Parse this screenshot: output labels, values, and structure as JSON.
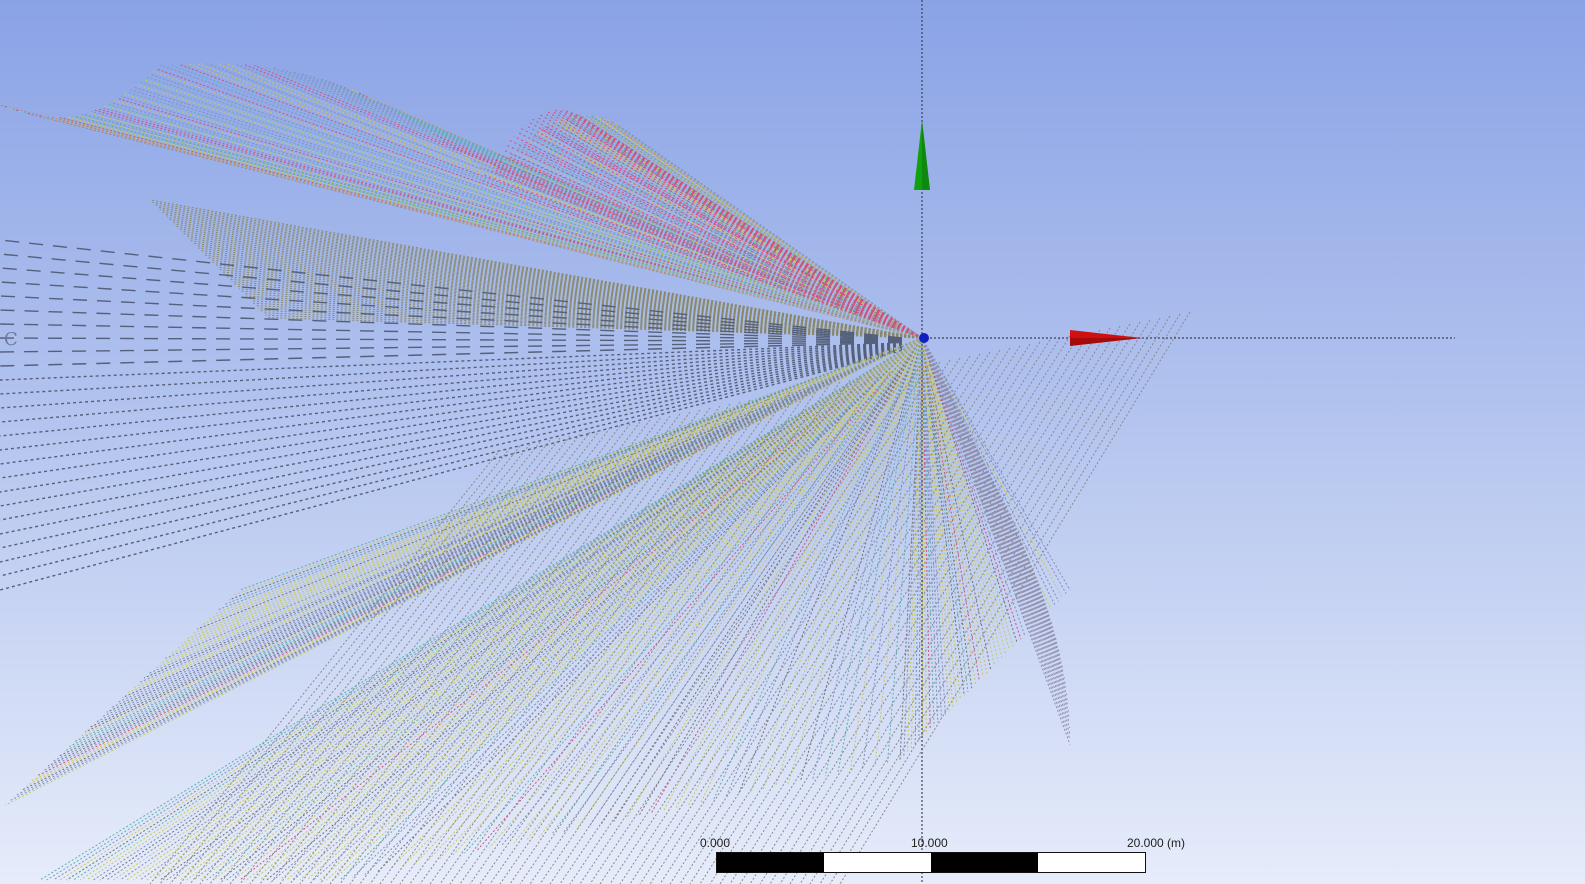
{
  "viewport": {
    "background_top": "#8aa3e6",
    "background_bottom": "#e6ecfa"
  },
  "scale_bar": {
    "labels": [
      "0.000",
      "10.000",
      "20.000 (m)"
    ]
  },
  "axis_triad": {
    "x_axis_color": "#d01010",
    "y_axis_color": "#10a010",
    "origin_color": "#1020c0",
    "edge_letter": "C"
  },
  "geometry": {
    "wire_colors": [
      "#c8c860",
      "#8090c0",
      "#d05080",
      "#60b0b0",
      "#606060",
      "#a0a0a0"
    ]
  }
}
